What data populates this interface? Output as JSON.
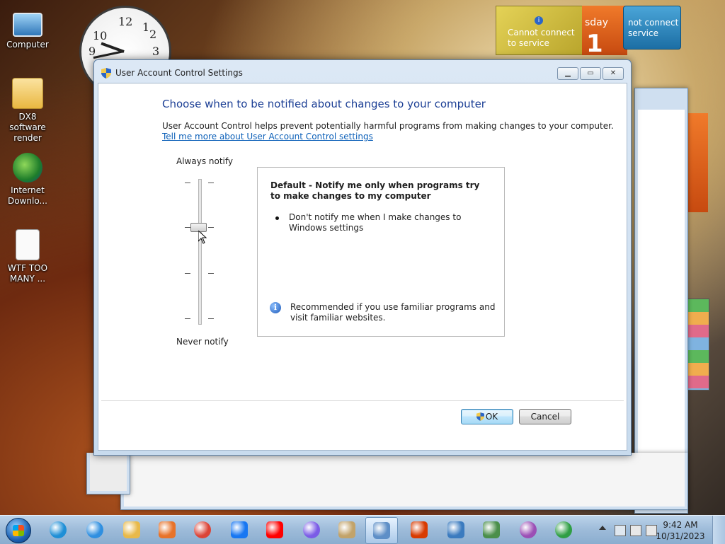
{
  "desktop": {
    "icons": [
      {
        "label": "Computer"
      },
      {
        "label": "DX8 software render"
      },
      {
        "label": "Internet Downlo..."
      },
      {
        "label": "WTF TOO MANY ..."
      }
    ],
    "clock_numbers": [
      "12",
      "1",
      "2",
      "3",
      "9",
      "10"
    ]
  },
  "gadgets": {
    "weather_text": "Cannot connect to service",
    "calendar_day_partial": "sday",
    "calendar_date": "1",
    "weather2_text": "not connect service"
  },
  "dialog": {
    "title": "User Account Control Settings",
    "heading": "Choose when to be notified about changes to your computer",
    "description": "User Account Control helps prevent potentially harmful programs from making changes to your computer.",
    "link": "Tell me more about User Account Control settings",
    "slider": {
      "top_label": "Always notify",
      "bottom_label": "Never notify",
      "levels": 4,
      "selected_level": 3
    },
    "info": {
      "title": "Default - Notify me only when programs try to make changes to my computer",
      "bullet": "Don't notify me when I make changes to Windows settings",
      "recommendation": "Recommended if you use familiar programs and visit familiar websites."
    },
    "buttons": {
      "ok": "OK",
      "cancel": "Cancel"
    }
  },
  "taskbar": {
    "apps": [
      {
        "name": "edge-icon",
        "color": "#1f8fd6"
      },
      {
        "name": "internet-explorer-icon",
        "color": "#2f8fe0"
      },
      {
        "name": "file-explorer-icon",
        "color": "#e8b94a"
      },
      {
        "name": "media-player-icon",
        "color": "#e7732a"
      },
      {
        "name": "chrome-icon",
        "color": "#db4437"
      },
      {
        "name": "facebook-icon",
        "color": "#1877f2"
      },
      {
        "name": "youtube-icon",
        "color": "#ff0000"
      },
      {
        "name": "copilot-icon",
        "color": "#7b5ce6"
      },
      {
        "name": "package-icon",
        "color": "#c2a36a"
      },
      {
        "name": "control-panel-icon",
        "color": "#5e8fc7"
      },
      {
        "name": "office-icon",
        "color": "#d83b01"
      },
      {
        "name": "remote-desktop-icon",
        "color": "#3b7bbf"
      },
      {
        "name": "document-viewer-icon",
        "color": "#4b8f4b"
      },
      {
        "name": "network-icon",
        "color": "#9b4fb5"
      },
      {
        "name": "internet-download-manager-icon",
        "color": "#2f9e44"
      }
    ],
    "time": "9:42 AM",
    "date": "10/31/2023"
  }
}
